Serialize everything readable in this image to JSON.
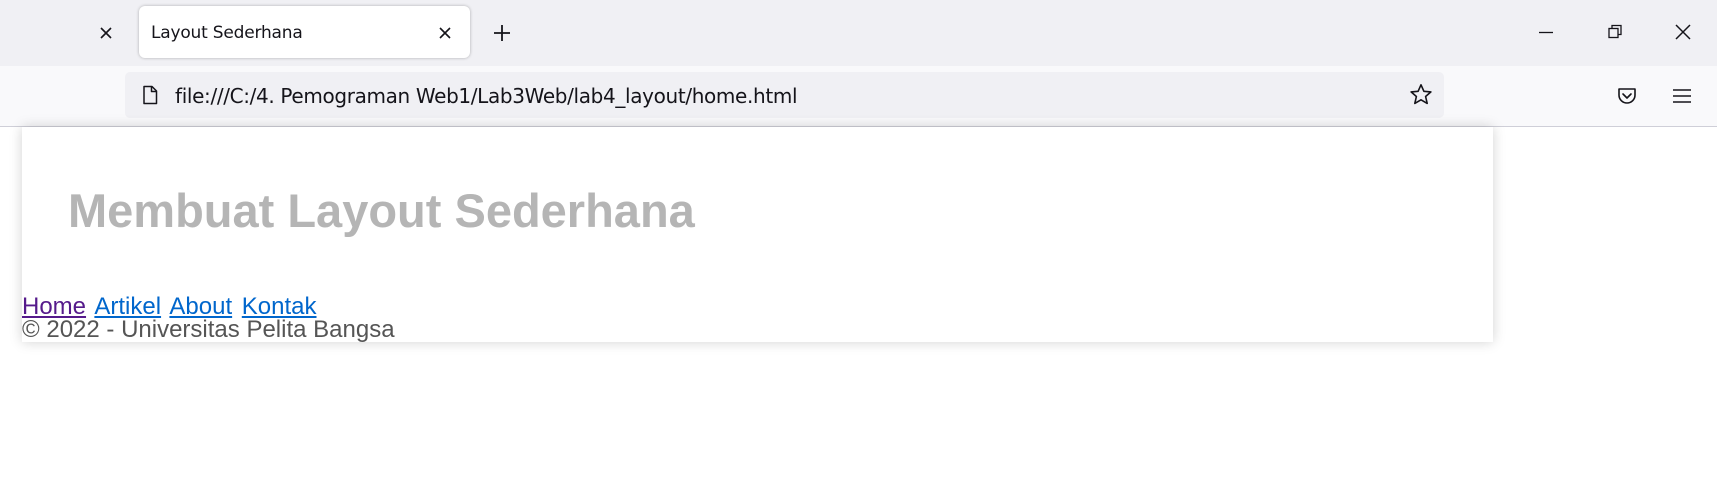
{
  "browser": {
    "tabs": [
      {
        "title": "",
        "active": false
      },
      {
        "title": "Layout Sederhana",
        "active": true
      }
    ],
    "url": "file:///C:/4. Pemograman Web1/Lab3Web/lab4_layout/home.html",
    "icons": {
      "tab_close": "close-icon",
      "new_tab": "plus-icon",
      "minimize": "minimize-icon",
      "restore": "restore-icon",
      "window_close": "close-icon",
      "page": "page-icon",
      "bookmark": "star-icon",
      "pocket": "pocket-icon",
      "menu": "hamburger-menu-icon"
    }
  },
  "page": {
    "header_title": "Membuat Layout Sederhana",
    "nav": [
      {
        "label": "Home",
        "visited": true
      },
      {
        "label": "Artikel",
        "visited": false
      },
      {
        "label": "About",
        "visited": false
      },
      {
        "label": "Kontak",
        "visited": false
      }
    ],
    "footer": "© 2022 - Universitas Pelita Bangsa"
  },
  "colors": {
    "title": "#b5b5b5",
    "link": "#0066cc",
    "link_visited": "#551a8b",
    "footer_text": "#555555",
    "tabstrip_bg": "#f0f0f4",
    "toolbar_bg": "#f9f9fb"
  }
}
